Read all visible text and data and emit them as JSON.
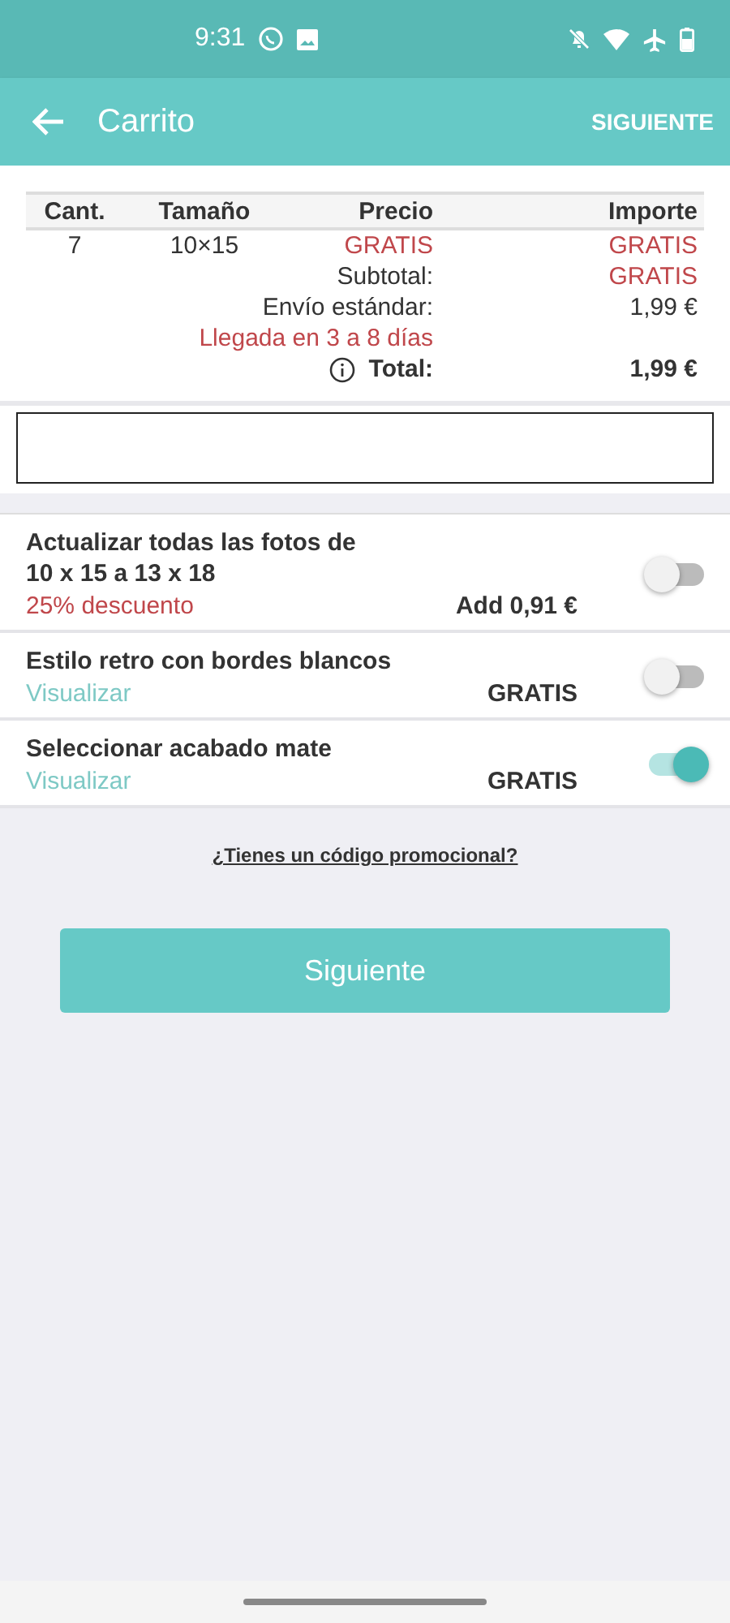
{
  "status_bar": {
    "time": "9:31"
  },
  "app_bar": {
    "title": "Carrito",
    "action": "SIGUIENTE"
  },
  "order": {
    "columns": [
      "Cant.",
      "Tamaño",
      "Precio",
      "Importe"
    ],
    "rows": [
      {
        "cells": [
          "7",
          "10×15",
          "GRATIS",
          "GRATIS"
        ]
      }
    ],
    "summary": [
      {
        "kind": "free",
        "label": "Subtotal:",
        "value": "GRATIS"
      },
      {
        "kind": "cost",
        "label": "Envío estándar:",
        "value": "1,99 €"
      },
      {
        "kind": "note",
        "label": "Llegada en 3 a 8 días"
      },
      {
        "kind": "total",
        "label": "Total:",
        "value": "1,99 €"
      }
    ]
  },
  "options": [
    {
      "kind": "discount",
      "title": "Actualizar todas las fotos de\n10 x 15 a 13 x 18",
      "note": "25% descuento",
      "price": "Add 0,91 €",
      "on": false
    },
    {
      "kind": "preview",
      "title": "Estilo retro con bordes blancos",
      "note": "Visualizar",
      "price": "GRATIS",
      "on": false
    },
    {
      "kind": "preview",
      "title": "Seleccionar acabado mate",
      "note": "Visualizar",
      "price": "GRATIS",
      "on": true
    }
  ],
  "promo_link": "¿Tienes un código promocional?",
  "next_button": "Siguiente"
}
